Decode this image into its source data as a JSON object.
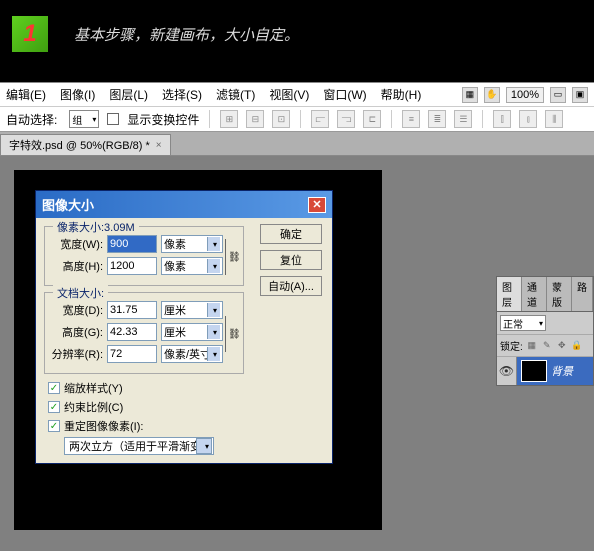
{
  "step": {
    "number": "1",
    "text": "基本步骤，新建画布，大小自定。"
  },
  "menu": {
    "edit": "编辑(E)",
    "image": "图像(I)",
    "layer": "图层(L)",
    "select": "选择(S)",
    "filter": "滤镜(T)",
    "view": "视图(V)",
    "window": "窗口(W)",
    "help": "帮助(H)",
    "zoom": "100%"
  },
  "options": {
    "label": "自动选择:",
    "combo": "组",
    "show_controls": "显示变换控件"
  },
  "doc_tab": "字特效.psd @ 50%(RGB/8) *",
  "dialog": {
    "title": "图像大小",
    "px_legend": "像素大小:3.09M",
    "width_label": "宽度(W):",
    "width_val": "900",
    "width_unit": "像素",
    "height_label": "高度(H):",
    "height_val": "1200",
    "height_unit": "像素",
    "doc_legend": "文档大小:",
    "dwidth_label": "宽度(D):",
    "dwidth_val": "31.75",
    "dwidth_unit": "厘米",
    "dheight_label": "高度(G):",
    "dheight_val": "42.33",
    "dheight_unit": "厘米",
    "res_label": "分辨率(R):",
    "res_val": "72",
    "res_unit": "像素/英寸",
    "scale_styles": "缩放样式(Y)",
    "constrain": "约束比例(C)",
    "resample": "重定图像像素(I):",
    "resample_method": "两次立方（适用于平滑渐变）",
    "ok": "确定",
    "reset": "复位",
    "auto": "自动(A)..."
  },
  "layers": {
    "tab1": "图层",
    "tab2": "通道",
    "tab3": "蒙版",
    "tab4": "路",
    "mode": "正常",
    "lock": "锁定:",
    "bg": "背景"
  }
}
